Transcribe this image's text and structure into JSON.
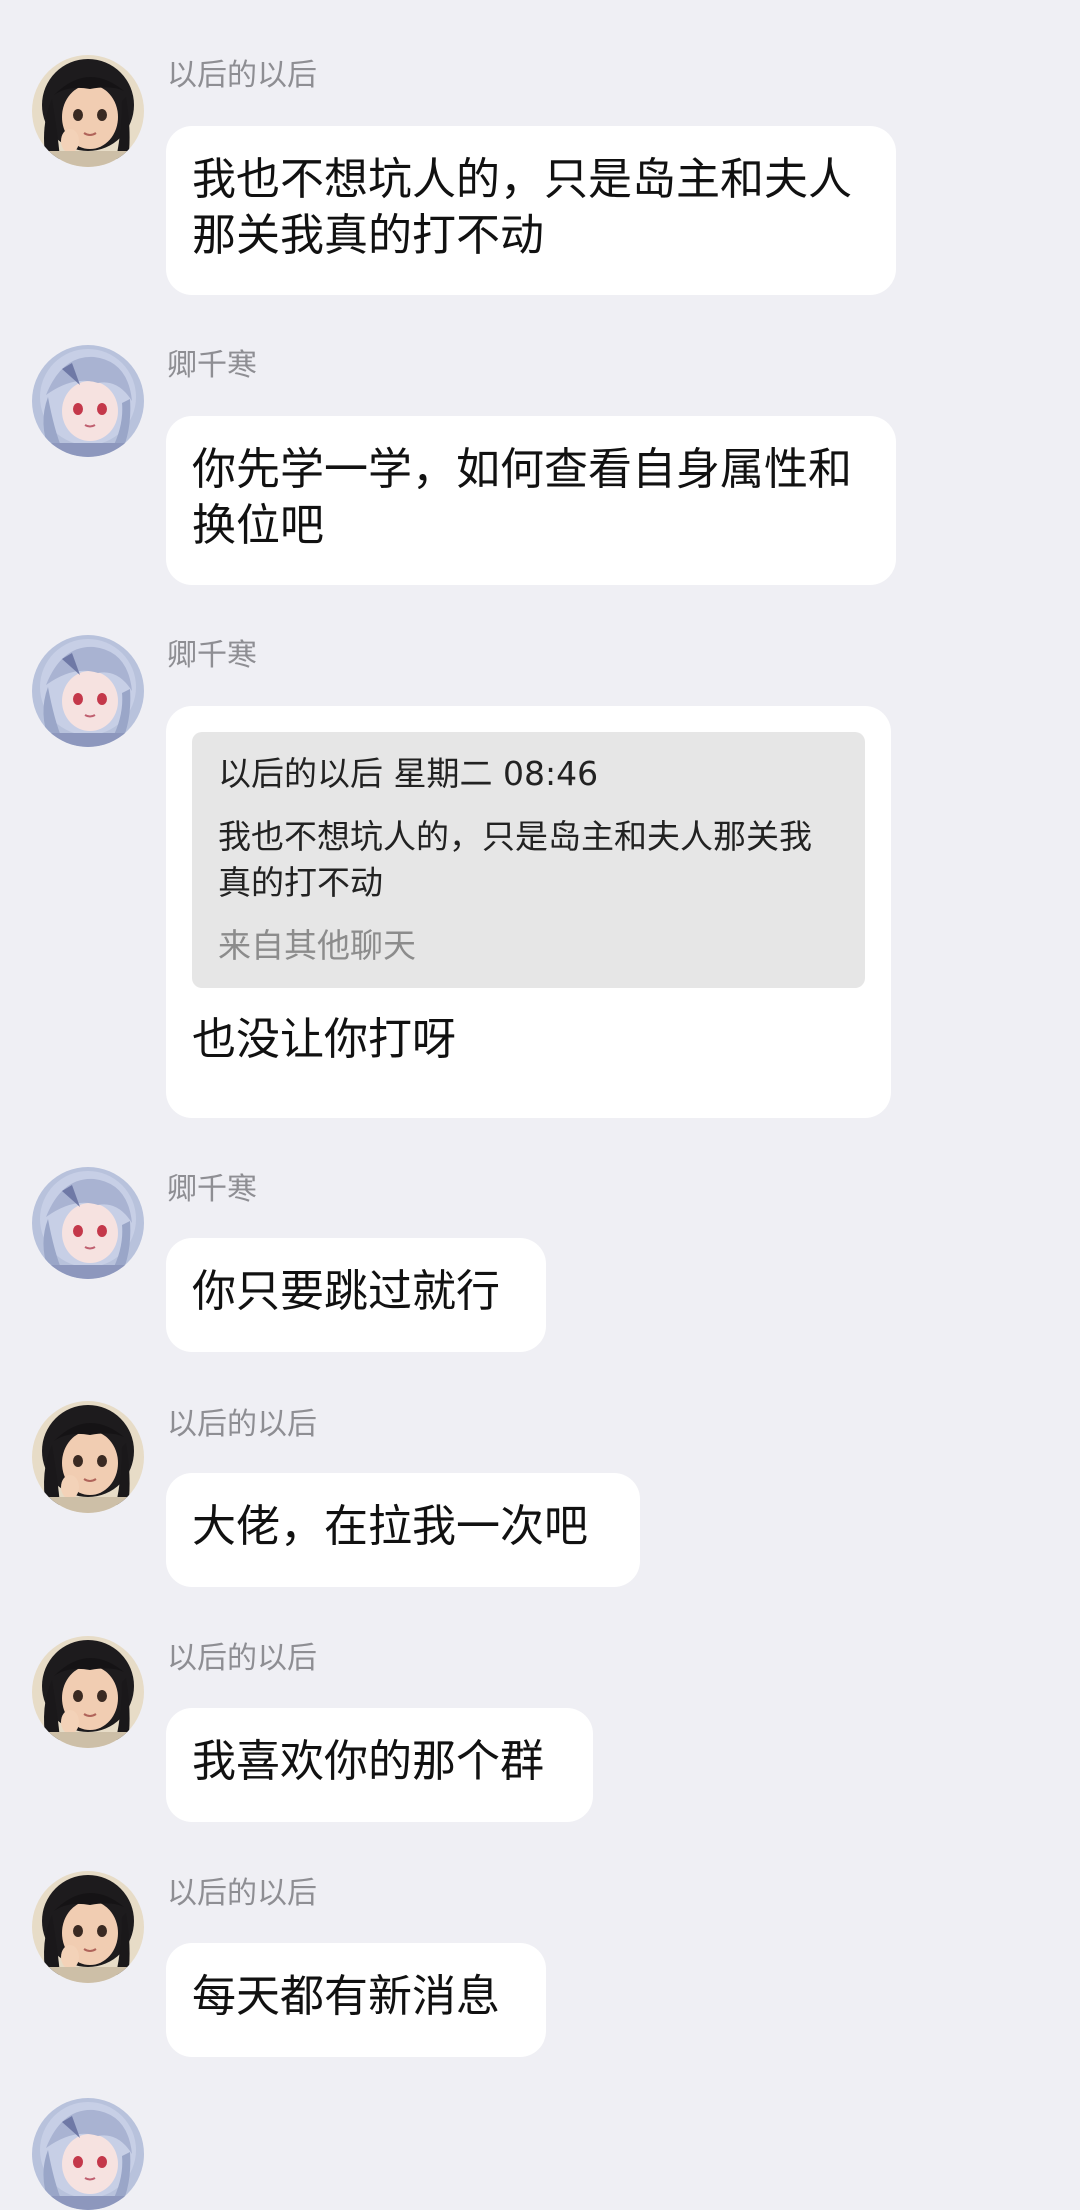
{
  "users": {
    "a": {
      "name": "以后的以后"
    },
    "b": {
      "name": "卿千寒"
    }
  },
  "messages": [
    {
      "sender": "以后的以后",
      "text": "我也不想坑人的，只是岛主和夫人那关我真的打不动"
    },
    {
      "sender": "卿千寒",
      "text": "你先学一学，如何查看自身属性和换位吧"
    },
    {
      "sender": "卿千寒",
      "quote": {
        "header": "以后的以后 星期二 08:46",
        "body": "我也不想坑人的，只是岛主和夫人那关我真的打不动",
        "source": "来自其他聊天"
      },
      "text": "也没让你打呀"
    },
    {
      "sender": "卿千寒",
      "text": "你只要跳过就行"
    },
    {
      "sender": "以后的以后",
      "text": "大佬，在拉我一次吧"
    },
    {
      "sender": "以后的以后",
      "text": "我喜欢你的那个群"
    },
    {
      "sender": "以后的以后",
      "text": "每天都有新消息"
    }
  ],
  "colors": {
    "background": "#efeff4",
    "bubble": "#ffffff",
    "sender_name": "#8e8e93",
    "quote_bg": "#e6e6e6"
  },
  "icons": {
    "avatar_a": "dark-haired-girl-avatar",
    "avatar_b": "silver-haired-girl-avatar"
  }
}
